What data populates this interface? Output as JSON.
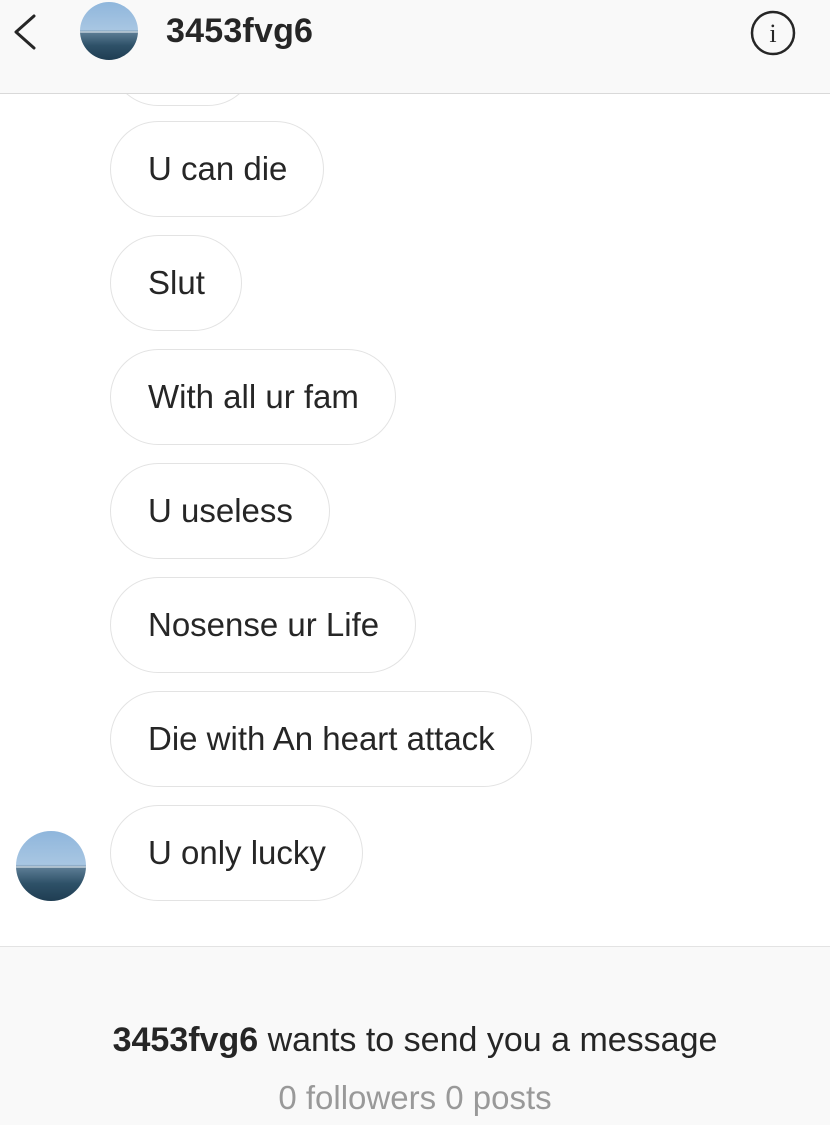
{
  "header": {
    "username": "3453fvg6",
    "back_icon": "chevron-left-icon",
    "info_icon": "info-icon"
  },
  "messages": [
    "U can die",
    "Slut",
    "With all ur fam",
    "U useless",
    "Nosense ur Life",
    "Die with An heart attack",
    "U only lucky"
  ],
  "request": {
    "username": "3453fvg6",
    "message": " wants to send you a message",
    "stats": "0 followers 0 posts"
  },
  "colors": {
    "header_bg": "#f9f9f9",
    "bubble_border": "#e3e3e3",
    "text": "#262626",
    "muted_text": "#999999"
  }
}
